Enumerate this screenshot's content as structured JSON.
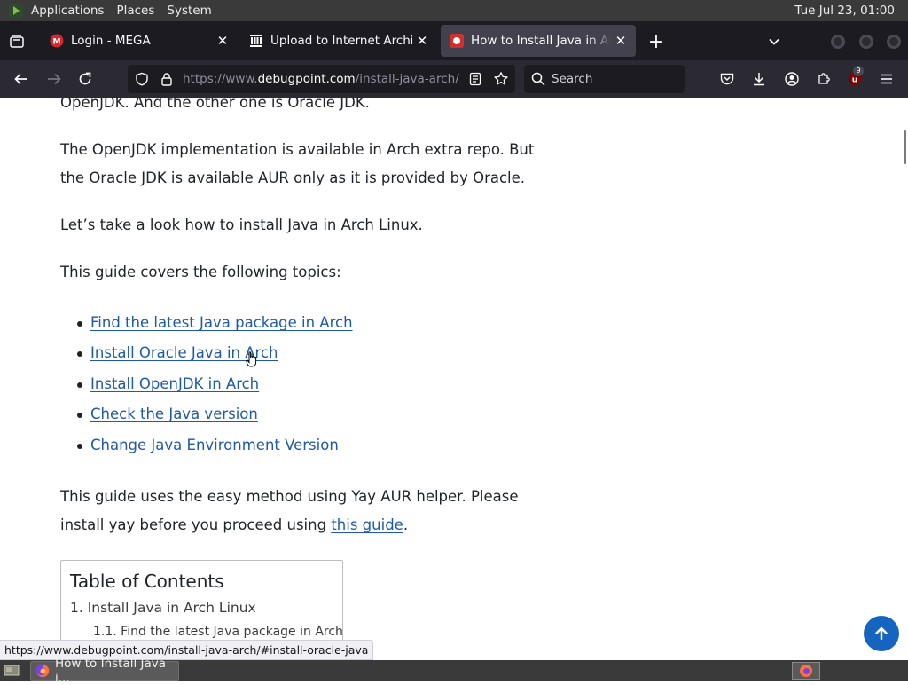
{
  "top_panel": {
    "menus": [
      "Applications",
      "Places",
      "System"
    ],
    "clock": "Tue Jul 23, 01:00"
  },
  "tabs": [
    {
      "title": "Login - MEGA",
      "icon": "mega-icon",
      "active": false
    },
    {
      "title": "Upload to Internet Archive",
      "icon": "internet-archive-icon",
      "active": false
    },
    {
      "title": "How to Install Java in Arch Linux",
      "icon": "debugpoint-icon",
      "active": true
    }
  ],
  "nav": {
    "url_prefix": "https://www.",
    "url_host": "debugpoint.com",
    "url_path": "/install-java-arch/",
    "search_placeholder": "Search",
    "extension_badge": "9"
  },
  "article": {
    "p0": "OpenJDK. And the other one is Oracle JDK.",
    "p1": "The OpenJDK implementation is available in Arch extra repo. But the Oracle JDK is available AUR only as it is provided by Oracle.",
    "p2": "Let’s take a look how to install Java in Arch Linux.",
    "p3": "This guide covers the following topics:",
    "topics": [
      "Find the latest Java package in Arch",
      "Install Oracle Java in Arch",
      "Install OpenJDK in Arch",
      "Check the Java version",
      "Change Java Environment Version"
    ],
    "p4_text": "This guide uses the easy method using Yay AUR helper. Please install yay before you proceed using ",
    "p4_link": "this guide",
    "p4_end": "."
  },
  "toc": {
    "title": "Table of Contents",
    "item_1": "1. Install Java in Arch Linux",
    "item_1_1": "1.1. Find the latest Java package in Arch"
  },
  "status_link": "https://www.debugpoint.com/install-java-arch/#install-oracle-java",
  "taskbar": {
    "task_title": "How to Install Java i..."
  },
  "colors": {
    "link": "#1e5aa8",
    "accent_blue": "#1565c0",
    "tab_strip": "#1c1b22",
    "toolbar": "#2b2a33",
    "panel": "#3a3a3a"
  }
}
